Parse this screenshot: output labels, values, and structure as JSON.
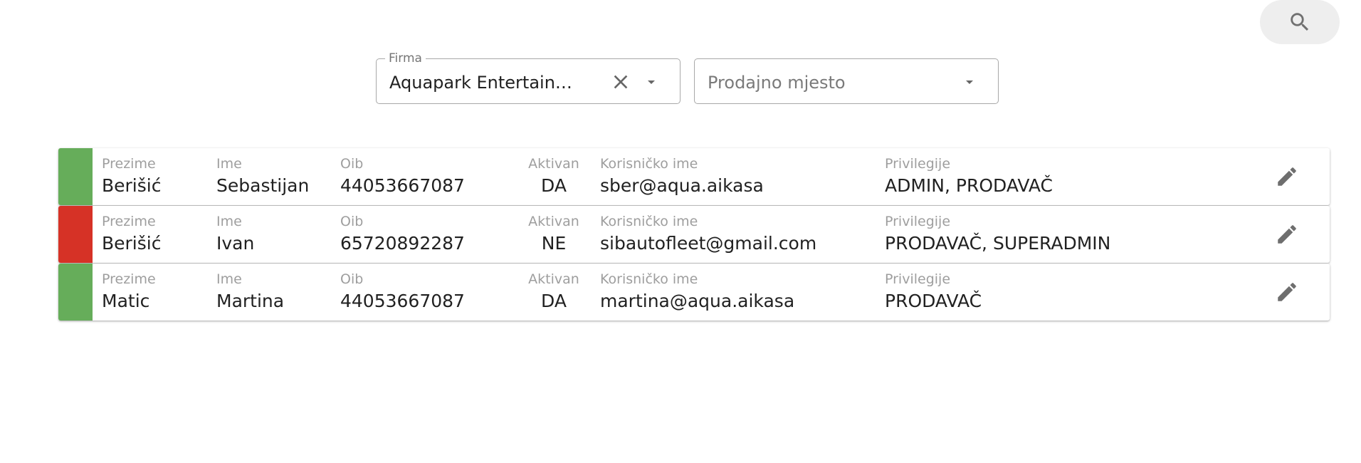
{
  "filters": {
    "firma": {
      "label": "Firma",
      "value": "Aquapark Entertainment"
    },
    "prodajno_mjesto": {
      "placeholder": "Prodajno mjesto"
    }
  },
  "columns": {
    "prezime": "Prezime",
    "ime": "Ime",
    "oib": "Oib",
    "aktivan": "Aktivan",
    "korisnicko_ime": "Korisničko ime",
    "privilegije": "Privilegije"
  },
  "colors": {
    "active": "#66ad5a",
    "inactive": "#d63226"
  },
  "users": [
    {
      "prezime": "Berišić",
      "ime": "Sebastijan",
      "oib": "44053667087",
      "aktivan": "DA",
      "korisnicko_ime": "sber@aqua.aikasa",
      "privilegije": "ADMIN, PRODAVAČ",
      "status_color": "#66ad5a"
    },
    {
      "prezime": "Berišić",
      "ime": "Ivan",
      "oib": "65720892287",
      "aktivan": "NE",
      "korisnicko_ime": "sibautofleet@gmail.com",
      "privilegije": "PRODAVAČ, SUPERADMIN",
      "status_color": "#d63226"
    },
    {
      "prezime": "Matic",
      "ime": "Martina",
      "oib": "44053667087",
      "aktivan": "DA",
      "korisnicko_ime": "martina@aqua.aikasa",
      "privilegije": "PRODAVAČ",
      "status_color": "#66ad5a"
    }
  ],
  "icons": {
    "search": "search-icon",
    "clear": "close-icon",
    "dropdown": "arrow-drop-down-icon",
    "edit": "pencil-icon"
  }
}
